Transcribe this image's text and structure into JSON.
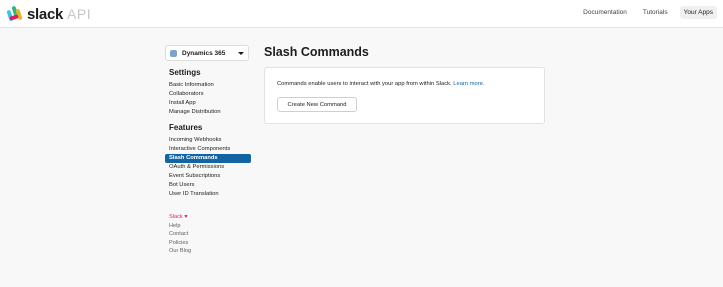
{
  "header": {
    "logo_word": "slack",
    "logo_suffix": "API",
    "nav": [
      "Documentation",
      "Tutorials",
      "Your Apps"
    ],
    "active_nav": "Your Apps"
  },
  "sidebar": {
    "app_name": "Dynamics 365",
    "settings_title": "Settings",
    "settings_items": [
      "Basic Information",
      "Collaborators",
      "Install App",
      "Manage Distribution"
    ],
    "features_title": "Features",
    "features_items": [
      "Incoming Webhooks",
      "Interactive Components",
      "Slash Commands",
      "OAuth & Permissions",
      "Event Subscriptions",
      "Bot Users",
      "User ID Translation"
    ],
    "active_item": "Slash Commands",
    "footer_slack": "Slack",
    "footer_heart": "♥",
    "footer_links": [
      "Help",
      "Contact",
      "Policies",
      "Our Blog"
    ]
  },
  "main": {
    "title": "Slash Commands",
    "description": "Commands enable users to interact with your app from within Slack.",
    "learn_more": "Learn more.",
    "create_button": "Create New Command"
  },
  "colors": {
    "accent": "#1264a3",
    "slack_red": "#e01e5a"
  }
}
